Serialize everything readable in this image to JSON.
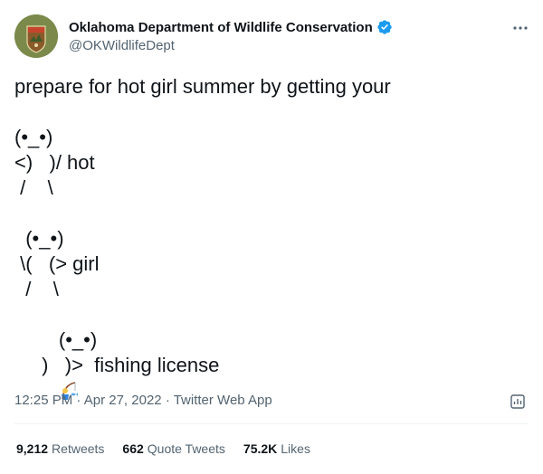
{
  "author": {
    "display_name": "Oklahoma Department of Wildlife Conservation",
    "handle": "@OKWildlifeDept",
    "verified": true,
    "avatar_icon": "odwc-badge-logo",
    "avatar_text": "OKLAHOMA WILDLIFE CONSERVATION"
  },
  "tweet": {
    "lines": [
      "prepare for hot girl summer by getting your",
      "",
      "(•_•)",
      "<)   )/ hot",
      " /    \\",
      "",
      "  (•_•)",
      " \\(   (> girl",
      "  /    \\",
      "",
      "        (•_•)",
      " )   )>  fishing license"
    ],
    "fishing_emoji": "person-fishing-emoji"
  },
  "meta": {
    "time": "12:25 PM",
    "separator": "·",
    "date": "Apr 27, 2022",
    "source": "Twitter Web App"
  },
  "stats": [
    {
      "count": "9,212",
      "label": "Retweets"
    },
    {
      "count": "662",
      "label": "Quote Tweets"
    },
    {
      "count": "75.2K",
      "label": "Likes"
    }
  ],
  "colors": {
    "text_primary": "#0f1419",
    "text_secondary": "#536471",
    "verified_blue": "#1d9bf0",
    "divider": "#eff3f4"
  }
}
